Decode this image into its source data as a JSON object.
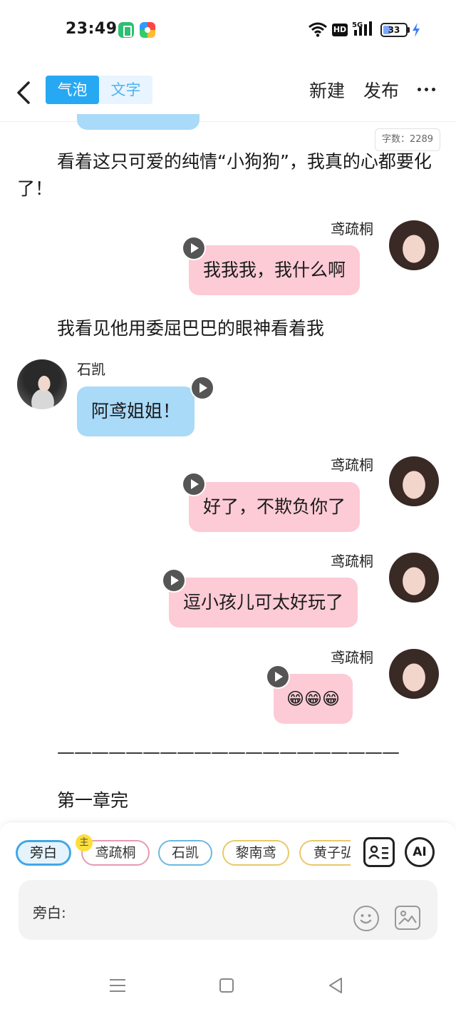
{
  "status_bar": {
    "time": "23:49",
    "battery_level": 33,
    "battery_label": "33",
    "network_label": "5G",
    "hd_label": "HD",
    "icons": [
      "app-green-icon",
      "app-colorful-icon",
      "wifi-icon",
      "hd-icon",
      "signal-5g-icon",
      "battery-icon",
      "charging-icon"
    ]
  },
  "header": {
    "back_icon": "chevron-left-icon",
    "tabs": [
      {
        "label": "气泡",
        "active": true
      },
      {
        "label": "文字",
        "active": false
      }
    ],
    "new_label": "新建",
    "publish_label": "发布",
    "more_icon": "more-horizontal-icon",
    "accent_color": "#27a8f2"
  },
  "word_count": "字数：2289",
  "content": {
    "narration_1": "看着这只可爱的纯情“小狗狗”，我真的心都要化了！",
    "narration_2": "我看见他用委屈巴巴的眼神看着我",
    "divider": "————————————————————",
    "narration_3": "第一章完",
    "messages": [
      {
        "speaker": "鸢疏桐",
        "text": "我我我，我什么啊",
        "side": "right",
        "color": "#fccbd6"
      },
      {
        "speaker": "石凯",
        "text": "阿鸢姐姐！",
        "side": "left",
        "color": "#a9daf8"
      },
      {
        "speaker": "鸢疏桐",
        "text": "好了，不欺负你了",
        "side": "right",
        "color": "#fccbd6"
      },
      {
        "speaker": "鸢疏桐",
        "text": "逗小孩儿可太好玩了",
        "side": "right",
        "color": "#fccbd6"
      },
      {
        "speaker": "鸢疏桐",
        "text": "😁😁😁",
        "side": "right",
        "color": "#fccbd6"
      }
    ]
  },
  "panel": {
    "chips": [
      {
        "label": "旁白",
        "selected": true
      },
      {
        "label": "鸢疏桐",
        "badge": "主"
      },
      {
        "label": "石凯"
      },
      {
        "label": "黎南鸢"
      },
      {
        "label": "黄子弘"
      }
    ],
    "roles_icon": "contact-card-icon",
    "ai_label": "AI",
    "input_label": "旁白:",
    "emoji_icon": "smiley-icon",
    "image_icon": "image-icon"
  },
  "nav": {
    "icons": [
      "menu-icon",
      "home-square-icon",
      "back-triangle-icon"
    ]
  }
}
